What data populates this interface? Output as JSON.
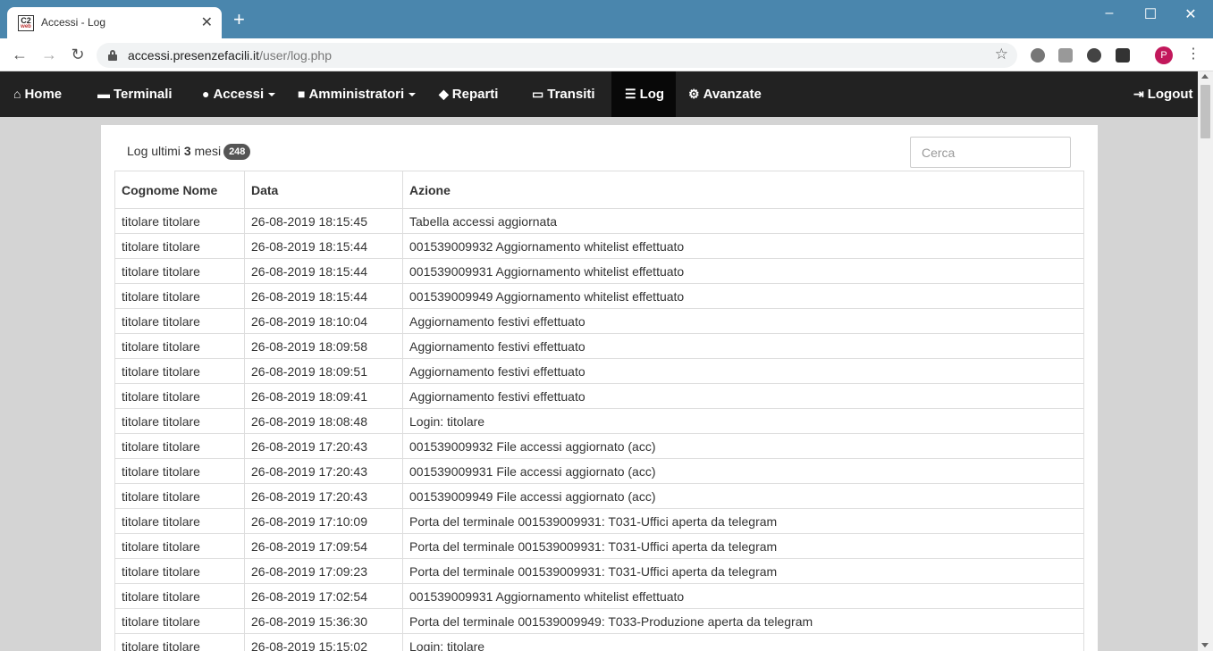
{
  "browser": {
    "tab_title": "Accessi - Log",
    "favicon_text": "C2",
    "favicon_sub": "web",
    "url_host": "accessi.presenzefacili.it",
    "url_path": "/user/log.php",
    "profile_initial": "P"
  },
  "nav": {
    "items": [
      {
        "label": "Home",
        "icon": "home-icon"
      },
      {
        "label": "Terminali",
        "icon": "printer-icon"
      },
      {
        "label": "Accessi",
        "icon": "user-icon",
        "dropdown": true
      },
      {
        "label": "Amministratori",
        "icon": "lock-icon",
        "dropdown": true
      },
      {
        "label": "Reparti",
        "icon": "tags-icon"
      },
      {
        "label": "Transiti",
        "icon": "card-icon"
      },
      {
        "label": "Log",
        "icon": "server-icon",
        "active": true
      },
      {
        "label": "Avanzate",
        "icon": "gear-icon"
      }
    ],
    "logout_label": "Logout"
  },
  "log": {
    "heading_prefix": "Log ultimi",
    "months": "3",
    "heading_suffix": "mesi",
    "count": "248",
    "search_placeholder": "Cerca",
    "columns": [
      "Cognome Nome",
      "Data",
      "Azione"
    ],
    "rows": [
      {
        "name": "titolare titolare",
        "date": "26-08-2019 18:15:45",
        "action": "Tabella accessi aggiornata"
      },
      {
        "name": "titolare titolare",
        "date": "26-08-2019 18:15:44",
        "action": "001539009932 Aggiornamento whitelist effettuato"
      },
      {
        "name": "titolare titolare",
        "date": "26-08-2019 18:15:44",
        "action": "001539009931 Aggiornamento whitelist effettuato"
      },
      {
        "name": "titolare titolare",
        "date": "26-08-2019 18:15:44",
        "action": "001539009949 Aggiornamento whitelist effettuato"
      },
      {
        "name": "titolare titolare",
        "date": "26-08-2019 18:10:04",
        "action": "Aggiornamento festivi effettuato"
      },
      {
        "name": "titolare titolare",
        "date": "26-08-2019 18:09:58",
        "action": "Aggiornamento festivi effettuato"
      },
      {
        "name": "titolare titolare",
        "date": "26-08-2019 18:09:51",
        "action": "Aggiornamento festivi effettuato"
      },
      {
        "name": "titolare titolare",
        "date": "26-08-2019 18:09:41",
        "action": "Aggiornamento festivi effettuato"
      },
      {
        "name": "titolare titolare",
        "date": "26-08-2019 18:08:48",
        "action": "Login: titolare"
      },
      {
        "name": "titolare titolare",
        "date": "26-08-2019 17:20:43",
        "action": "001539009932 File accessi aggiornato (acc)"
      },
      {
        "name": "titolare titolare",
        "date": "26-08-2019 17:20:43",
        "action": "001539009931 File accessi aggiornato (acc)"
      },
      {
        "name": "titolare titolare",
        "date": "26-08-2019 17:20:43",
        "action": "001539009949 File accessi aggiornato (acc)"
      },
      {
        "name": "titolare titolare",
        "date": "26-08-2019 17:10:09",
        "action": "Porta del terminale 001539009931: T031-Uffici aperta da telegram"
      },
      {
        "name": "titolare titolare",
        "date": "26-08-2019 17:09:54",
        "action": "Porta del terminale 001539009931: T031-Uffici aperta da telegram"
      },
      {
        "name": "titolare titolare",
        "date": "26-08-2019 17:09:23",
        "action": "Porta del terminale 001539009931: T031-Uffici aperta da telegram"
      },
      {
        "name": "titolare titolare",
        "date": "26-08-2019 17:02:54",
        "action": "001539009931 Aggiornamento whitelist effettuato"
      },
      {
        "name": "titolare titolare",
        "date": "26-08-2019 15:36:30",
        "action": "Porta del terminale 001539009949: T033-Produzione aperta da telegram"
      },
      {
        "name": "titolare titolare",
        "date": "26-08-2019 15:15:02",
        "action": "Login: titolare"
      }
    ]
  }
}
